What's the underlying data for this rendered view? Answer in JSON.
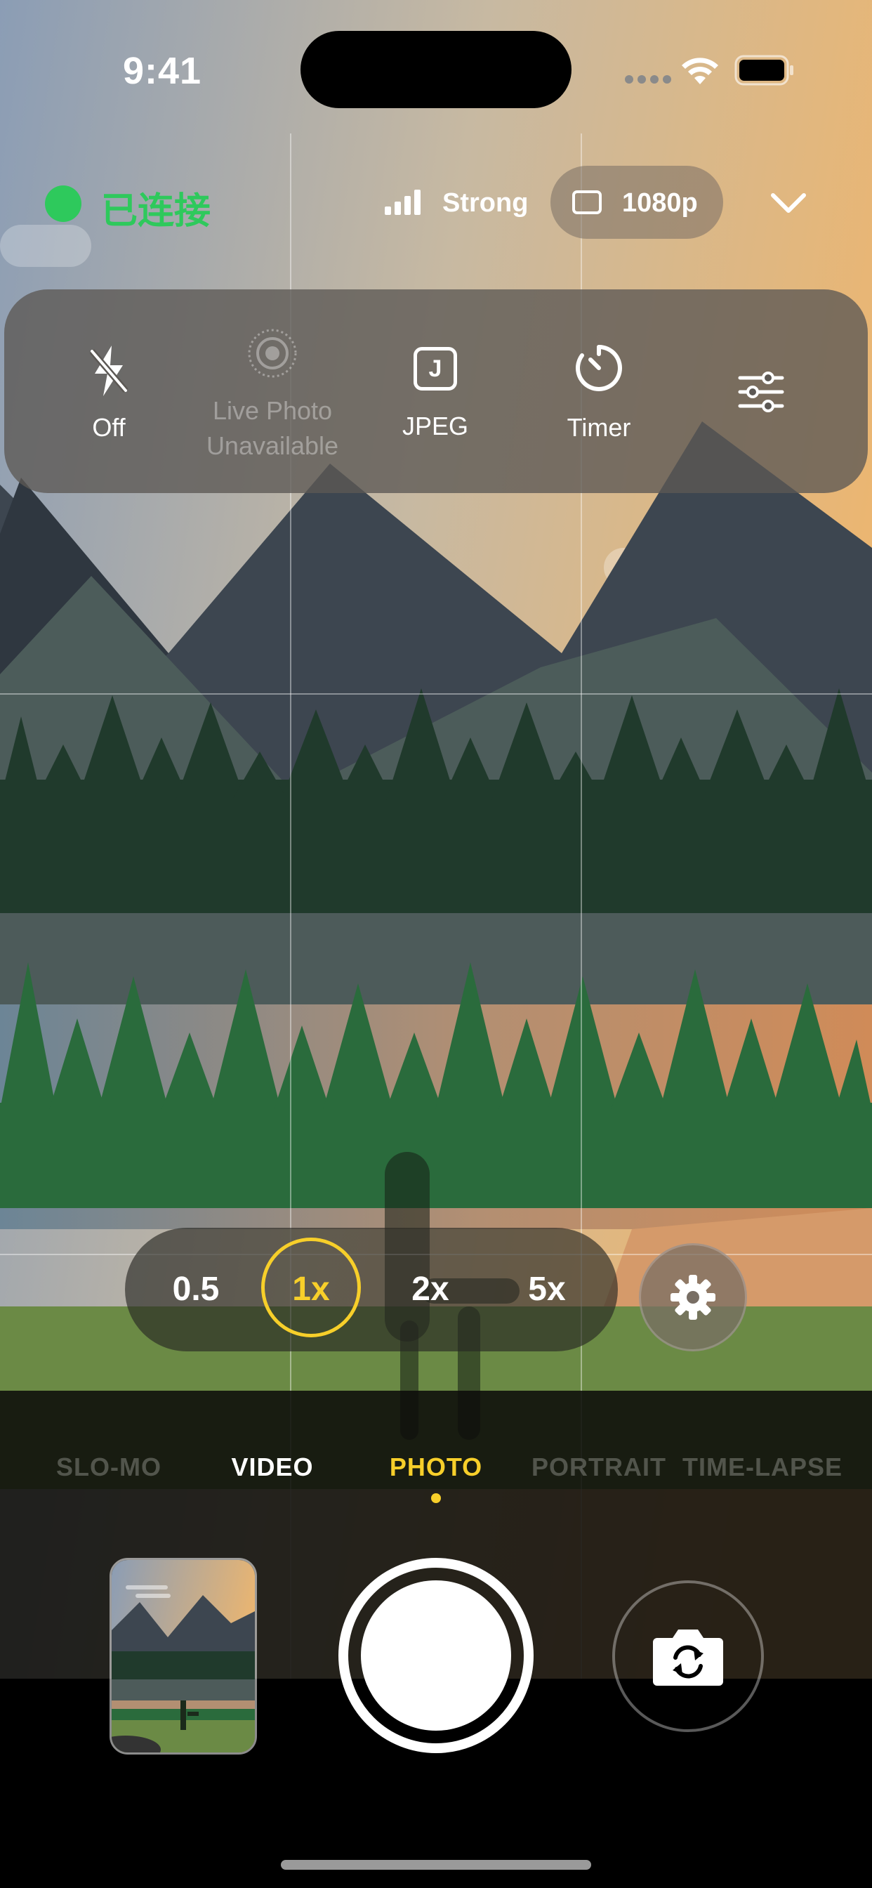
{
  "status_bar": {
    "time": "9:41"
  },
  "connection": {
    "label": "已连接",
    "color": "#2ec95c"
  },
  "signal": {
    "label": "Strong"
  },
  "resolution": {
    "label": "1080p"
  },
  "controls": {
    "flash": {
      "label": "Off",
      "icon": "flash-off-icon"
    },
    "live_photo": {
      "line1": "Live Photo",
      "line2": "Unavailable",
      "icon": "live-photo-icon"
    },
    "format": {
      "label": "JPEG",
      "badge": "J",
      "icon": "jpeg-format-icon"
    },
    "timer": {
      "label": "Timer",
      "icon": "timer-icon"
    },
    "adjust": {
      "icon": "sliders-icon"
    }
  },
  "zoom": {
    "options": [
      "0.5",
      "1x",
      "2x",
      "5x"
    ],
    "selected": "1x"
  },
  "modes": {
    "items": [
      "SLO-MO",
      "VIDEO",
      "PHOTO",
      "PORTRAIT",
      "TIME-LAPSE"
    ],
    "selected": "PHOTO"
  },
  "colors": {
    "accent": "#f7cf2a",
    "connected": "#2ec95c"
  }
}
